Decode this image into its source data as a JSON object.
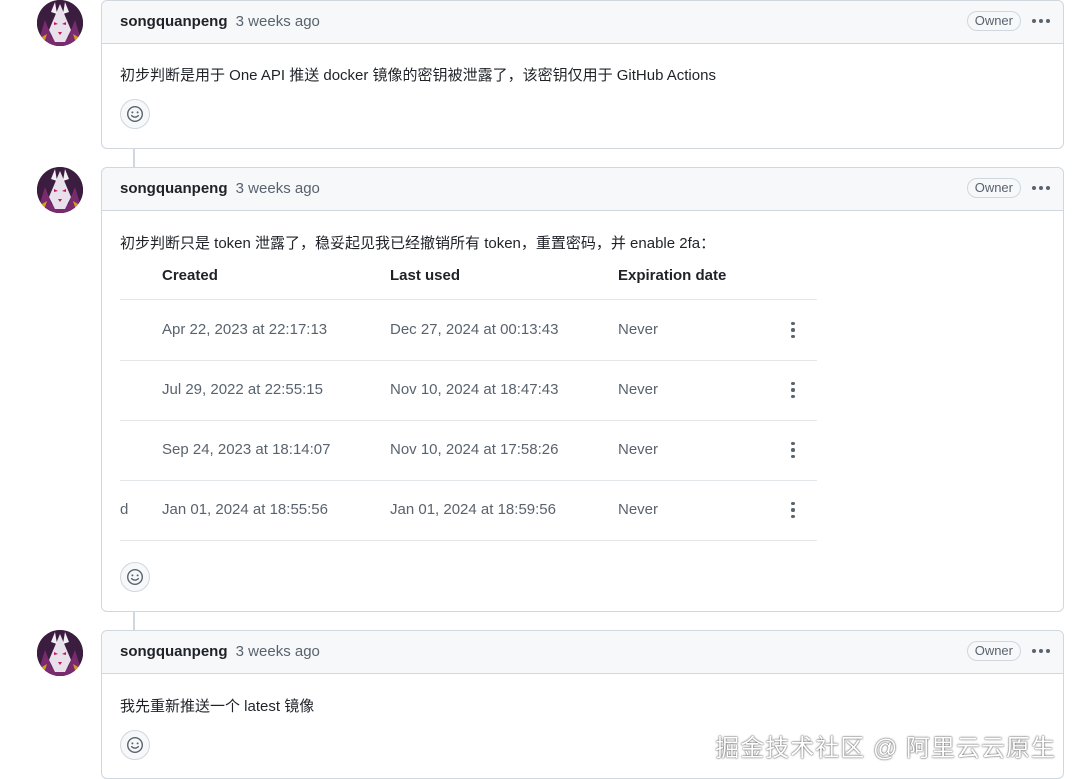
{
  "comments": [
    {
      "author": "songquanpeng",
      "time": "3 weeks ago",
      "badge": "Owner",
      "text": "初步判断是用于 One API 推送 docker 镜像的密钥被泄露了，该密钥仅用于 GitHub Actions"
    },
    {
      "author": "songquanpeng",
      "time": "3 weeks ago",
      "badge": "Owner",
      "text": "初步判断只是 token 泄露了，稳妥起见我已经撤销所有 token，重置密码，并 enable 2fa：",
      "table": {
        "headers": [
          "Created",
          "Last used",
          "Expiration date"
        ],
        "rows": [
          {
            "created": "Apr 22, 2023 at 22:17:13",
            "last_used": "Dec 27, 2024 at 00:13:43",
            "expiration": "Never"
          },
          {
            "created": "Jul 29, 2022 at 22:55:15",
            "last_used": "Nov 10, 2024 at 18:47:43",
            "expiration": "Never"
          },
          {
            "created": "Sep 24, 2023 at 18:14:07",
            "last_used": "Nov 10, 2024 at 17:58:26",
            "expiration": "Never"
          },
          {
            "created": "Jan 01, 2024 at 18:55:56",
            "last_used": "Jan 01, 2024 at 18:59:56",
            "expiration": "Never",
            "cut_prefix": "d"
          }
        ]
      }
    },
    {
      "author": "songquanpeng",
      "time": "3 weeks ago",
      "badge": "Owner",
      "text": "我先重新推送一个 latest 镜像"
    }
  ],
  "watermark": "掘金技术社区 @ 阿里云云原生",
  "icons": {
    "avatar": "avatar-icon",
    "kebab": "kebab-horizontal-icon",
    "row_kebab": "kebab-vertical-icon",
    "emoji": "smiley-icon"
  },
  "colors": {
    "border": "#d0d7de",
    "header_bg": "#f6f8fa",
    "muted_text": "#59636e",
    "text": "#1f2328"
  }
}
